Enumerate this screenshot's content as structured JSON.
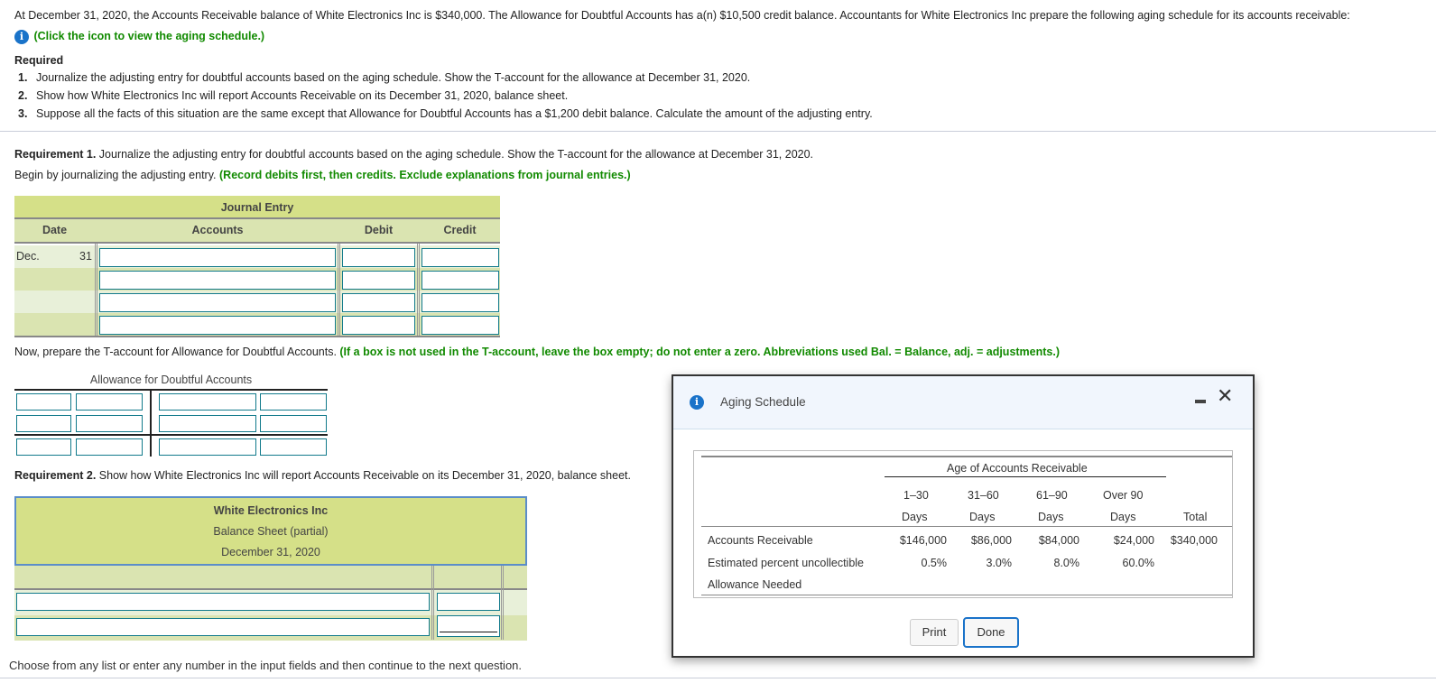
{
  "intro": {
    "text": "At December 31, 2020, the Accounts Receivable balance of White Electronics Inc is $340,000. The Allowance for Doubtful Accounts has a(n) $10,500 credit balance. Accountants for White Electronics Inc prepare the following aging schedule for its accounts receivable:",
    "icon_link": "(Click the icon to view the aging schedule.)"
  },
  "required": {
    "heading": "Required",
    "items": [
      {
        "num": "1.",
        "text": "Journalize the adjusting entry for doubtful accounts based on the aging schedule. Show the T-account for the allowance at December 31, 2020."
      },
      {
        "num": "2.",
        "text": "Show how White Electronics Inc will report Accounts Receivable on its December 31, 2020, balance sheet."
      },
      {
        "num": "3.",
        "text": "Suppose all the facts of this situation are the same except that Allowance for Doubtful Accounts has a $1,200 debit balance. Calculate the amount of the adjusting entry."
      }
    ]
  },
  "req1": {
    "label": "Requirement 1.",
    "text": " Journalize the adjusting entry for doubtful accounts based on the aging schedule. Show the T-account for the allowance at December 31, 2020.",
    "begin": "Begin by journalizing the adjusting entry. ",
    "begin_note": "(Record debits first, then credits. Exclude explanations from journal entries.)"
  },
  "journal": {
    "title": "Journal Entry",
    "headers": {
      "date": "Date",
      "accounts": "Accounts",
      "debit": "Debit",
      "credit": "Credit"
    },
    "first_row": {
      "month": "Dec.",
      "day": "31"
    },
    "rows": [
      {
        "account": "",
        "debit": "",
        "credit": ""
      },
      {
        "account": "",
        "debit": "",
        "credit": ""
      },
      {
        "account": "",
        "debit": "",
        "credit": ""
      },
      {
        "account": "",
        "debit": "",
        "credit": ""
      }
    ]
  },
  "taccount": {
    "instruction": "Now, prepare the T-account for Allowance for Doubtful Accounts. ",
    "instruction_note": "(If a box is not used in the T-account, leave the box empty; do not enter a zero. Abbreviations used Bal. = Balance, adj. = adjustments.)",
    "title": "Allowance for Doubtful Accounts"
  },
  "req2": {
    "label": "Requirement 2.",
    "text": " Show how White Electronics Inc will report Accounts Receivable on its December 31, 2020, balance sheet."
  },
  "balance_sheet": {
    "company": "White Electronics Inc",
    "title": "Balance Sheet (partial)",
    "date": "December 31, 2020"
  },
  "footer": "Choose from any list or enter any number in the input fields and then continue to the next question.",
  "modal": {
    "title": "Aging Schedule",
    "group_header": "Age of Accounts Receivable",
    "columns": [
      {
        "line1": "1–30",
        "line2": "Days"
      },
      {
        "line1": "31–60",
        "line2": "Days"
      },
      {
        "line1": "61–90",
        "line2": "Days"
      },
      {
        "line1": "Over 90",
        "line2": "Days"
      },
      {
        "line1": "",
        "line2": "Total"
      }
    ],
    "rows": [
      {
        "label": "Accounts Receivable",
        "values": [
          "$146,000",
          "$86,000",
          "$84,000",
          "$24,000",
          "$340,000"
        ]
      },
      {
        "label": "Estimated percent uncollectible",
        "values": [
          "0.5%",
          "3.0%",
          "8.0%",
          "60.0%",
          ""
        ]
      },
      {
        "label": "Allowance Needed",
        "values": [
          "",
          "",
          "",
          "",
          ""
        ]
      }
    ],
    "print_label": "Print",
    "done_label": "Done"
  },
  "colors": {
    "instruction_green": "#118a00",
    "header_green": "#d5e088",
    "input_border": "#117a8b",
    "accent_blue": "#1a73c9"
  }
}
